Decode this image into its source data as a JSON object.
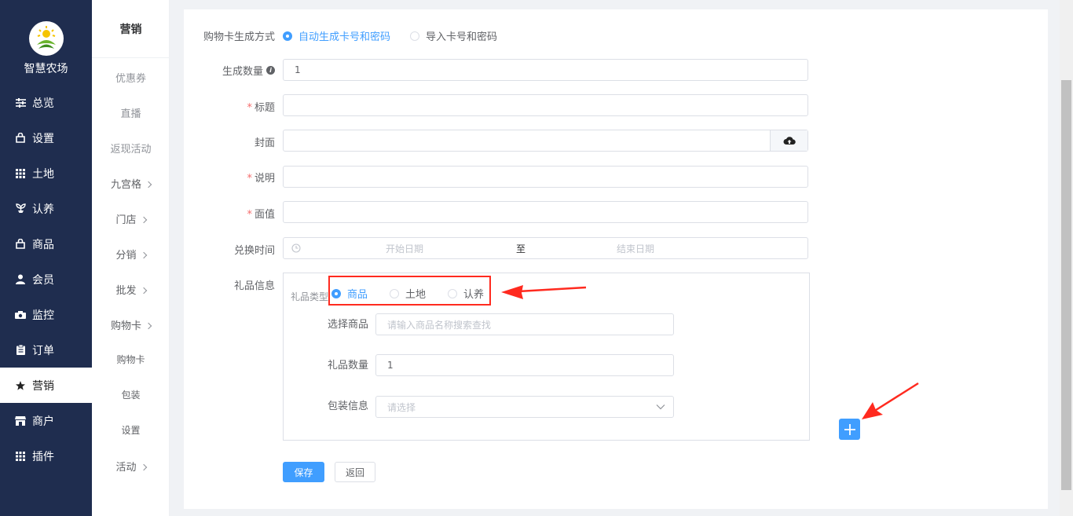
{
  "brand": {
    "name": "智慧农场"
  },
  "nav": [
    {
      "label": "总览",
      "icon": "sliders-icon"
    },
    {
      "label": "设置",
      "icon": "bag-icon"
    },
    {
      "label": "土地",
      "icon": "grid-icon"
    },
    {
      "label": "认养",
      "icon": "plant-icon"
    },
    {
      "label": "商品",
      "icon": "bag-icon"
    },
    {
      "label": "会员",
      "icon": "user-icon"
    },
    {
      "label": "监控",
      "icon": "camera-icon"
    },
    {
      "label": "订单",
      "icon": "clipboard-icon"
    },
    {
      "label": "营销",
      "icon": "star-icon"
    },
    {
      "label": "商户",
      "icon": "store-icon"
    },
    {
      "label": "插件",
      "icon": "grid-icon"
    }
  ],
  "subnav": {
    "title": "营销",
    "items": [
      {
        "label": "优惠券"
      },
      {
        "label": "直播"
      },
      {
        "label": "返现活动"
      },
      {
        "label": "九宫格"
      },
      {
        "label": "门店"
      },
      {
        "label": "分销"
      },
      {
        "label": "批发"
      },
      {
        "label": "购物卡"
      },
      {
        "label": "购物卡"
      },
      {
        "label": "包装"
      },
      {
        "label": "设置"
      },
      {
        "label": "活动"
      }
    ]
  },
  "form": {
    "gen_method": {
      "label": "购物卡生成方式",
      "option_auto": "自动生成卡号和密码",
      "option_import": "导入卡号和密码"
    },
    "quantity": {
      "label": "生成数量",
      "value": "1"
    },
    "title": {
      "label": "标题",
      "value": ""
    },
    "cover": {
      "label": "封面",
      "value": ""
    },
    "description": {
      "label": "说明",
      "value": ""
    },
    "face_value": {
      "label": "面值",
      "value": ""
    },
    "redeem_time": {
      "label": "兑换时间",
      "start_placeholder": "开始日期",
      "separator": "至",
      "end_placeholder": "结束日期"
    },
    "gift": {
      "label": "礼品信息",
      "type_label": "礼品类型",
      "type_options": [
        "商品",
        "土地",
        "认养"
      ],
      "selected_type": "商品",
      "product_label": "选择商品",
      "product_placeholder": "请输入商品名称搜索查找",
      "gift_qty_label": "礼品数量",
      "gift_qty_value": "1",
      "package_label": "包装信息",
      "package_placeholder": "请选择"
    },
    "save_label": "保存",
    "back_label": "返回"
  },
  "colors": {
    "primary": "#409eff",
    "sidebar": "#1f2d4f",
    "annotation": "#ff2a1f"
  }
}
